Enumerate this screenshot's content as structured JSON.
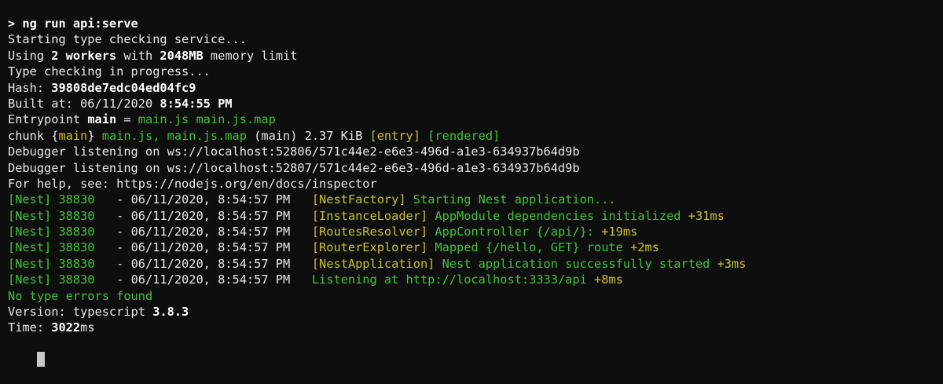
{
  "terminal": {
    "lines": [
      [
        [
          "b",
          "> ng run api:serve"
        ]
      ],
      [
        [
          "w",
          "Starting type checking service..."
        ]
      ],
      [
        [
          "w",
          "Using "
        ],
        [
          "b",
          "2 workers"
        ],
        [
          "w",
          " with "
        ],
        [
          "b",
          "2048MB"
        ],
        [
          "w",
          " memory limit"
        ]
      ],
      [
        [
          "w",
          "Type checking in progress..."
        ]
      ],
      [
        [
          "w",
          "Hash: "
        ],
        [
          "b",
          "39808de7edc04ed04fc9"
        ]
      ],
      [
        [
          "w",
          "Built at: 06/11/2020 "
        ],
        [
          "b",
          "8:54:55 PM"
        ]
      ],
      [
        [
          "w",
          "Entrypoint "
        ],
        [
          "b",
          "main"
        ],
        [
          "w",
          " = "
        ],
        [
          "g",
          "main.js main.js.map"
        ]
      ],
      [
        [
          "w",
          "chunk {"
        ],
        [
          "y",
          "main"
        ],
        [
          "w",
          "} "
        ],
        [
          "g",
          "main.js, main.js.map"
        ],
        [
          "w",
          " (main) 2.37 KiB "
        ],
        [
          "y",
          "[entry]"
        ],
        [
          "w",
          " "
        ],
        [
          "g",
          "[rendered]"
        ]
      ],
      [
        [
          "w",
          "Debugger listening on ws://localhost:52806/571c44e2-e6e3-496d-a1e3-634937b64d9b"
        ]
      ],
      [
        [
          "w",
          "Debugger listening on ws://localhost:52807/571c44e2-e6e3-496d-a1e3-634937b64d9b"
        ]
      ],
      [
        [
          "w",
          "For help, see: https://nodejs.org/en/docs/inspector"
        ]
      ],
      [
        [
          "g",
          "[Nest] 38830   "
        ],
        [
          "w",
          "- 06/11/2020, 8:54:57 PM   "
        ],
        [
          "y",
          "[NestFactory]"
        ],
        [
          "g",
          " Starting Nest application..."
        ]
      ],
      [
        [
          "g",
          "[Nest] 38830   "
        ],
        [
          "w",
          "- 06/11/2020, 8:54:57 PM   "
        ],
        [
          "y",
          "[InstanceLoader]"
        ],
        [
          "g",
          " AppModule dependencies initialized"
        ],
        [
          "y",
          " +31ms"
        ]
      ],
      [
        [
          "g",
          "[Nest] 38830   "
        ],
        [
          "w",
          "- 06/11/2020, 8:54:57 PM   "
        ],
        [
          "y",
          "[RoutesResolver]"
        ],
        [
          "g",
          " AppController {/api/}:"
        ],
        [
          "y",
          " +19ms"
        ]
      ],
      [
        [
          "g",
          "[Nest] 38830   "
        ],
        [
          "w",
          "- 06/11/2020, 8:54:57 PM   "
        ],
        [
          "y",
          "[RouterExplorer]"
        ],
        [
          "g",
          " Mapped {/hello, GET} route"
        ],
        [
          "y",
          " +2ms"
        ]
      ],
      [
        [
          "g",
          "[Nest] 38830   "
        ],
        [
          "w",
          "- 06/11/2020, 8:54:57 PM   "
        ],
        [
          "y",
          "[NestApplication]"
        ],
        [
          "g",
          " Nest application successfully started"
        ],
        [
          "y",
          " +3ms"
        ]
      ],
      [
        [
          "g",
          "[Nest] 38830   "
        ],
        [
          "w",
          "- 06/11/2020, 8:54:57 PM   "
        ],
        [
          "g",
          "Listening at http://localhost:3333/api"
        ],
        [
          "y",
          " +8ms"
        ]
      ],
      [
        [
          "g",
          "No type errors found"
        ]
      ],
      [
        [
          "w",
          "Version: typescript "
        ],
        [
          "b",
          "3.8.3"
        ]
      ],
      [
        [
          "w",
          "Time: "
        ],
        [
          "b",
          "3022"
        ],
        [
          "w",
          "ms"
        ]
      ]
    ],
    "colors": {
      "background": "#0e0e0e",
      "text": "#e8e8e8",
      "green": "#3fc53a",
      "yellow": "#c7c32e",
      "cursor": "#c8c8c8"
    }
  }
}
